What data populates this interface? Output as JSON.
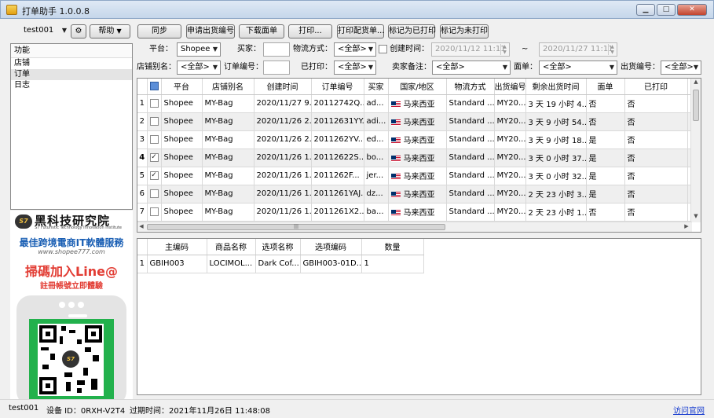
{
  "window": {
    "title": "打单助手 1.0.0.8",
    "icon": "app-icon",
    "min": "▁",
    "max": "□",
    "close": "✕"
  },
  "toolbar": {
    "account": "test001",
    "settings_icon": "gear-icon",
    "help": "帮助",
    "sync": "同步",
    "apply_tracking": "申请出货编号",
    "download_waybill": "下载面单",
    "print": "打印...",
    "print_picklist": "打印配货单...",
    "mark_printed": "标记为已打印",
    "mark_unprinted": "标记为未打印"
  },
  "filters": {
    "platform_label": "平台：",
    "platform": "Shopee",
    "buyer_label": "买家：",
    "buyer": "",
    "logistics_label": "物流方式：",
    "logistics": "<全部>",
    "created_label": "创建时间：",
    "created_checked": false,
    "date_from": "2020/11/12 11:11",
    "date_sep": "~",
    "date_to": "2020/11/27 11:11",
    "store_label": "店铺别名：",
    "store": "<全部>",
    "order_label": "订单编号：",
    "order": "",
    "printed_label": "已打印：",
    "printed": "<全部>",
    "seller_note_label": "卖家备注：",
    "seller_note": "<全部>",
    "waybill_label": "面单：",
    "waybill": "<全部>",
    "shipno_label": "出货编号：",
    "shipno": "<全部>"
  },
  "sidebar": {
    "header": "功能",
    "items": [
      {
        "label": "店铺",
        "selected": false
      },
      {
        "label": "订单",
        "selected": true
      },
      {
        "label": "日志",
        "selected": false
      }
    ]
  },
  "promo": {
    "logo": "S7",
    "brand": "黑科技研究院",
    "brand_sub": "S7 Futuristic Technology Innovation Institute",
    "slogan": "最佳跨境電商IT軟體服務",
    "url": "www.shopee777.com",
    "scan": "掃碼加入Line@",
    "scan_sub": "註冊帳號立即體驗"
  },
  "orders": {
    "columns": [
      "",
      "平台",
      "店铺别名",
      "创建时间",
      "订单编号",
      "买家",
      "国家/地区",
      "物流方式",
      "出货编号",
      "剩余出货时间",
      "面单",
      "已打印",
      ""
    ],
    "rows": [
      {
        "n": "1",
        "checked": false,
        "platform": "Shopee",
        "store": "MY-Bag",
        "created": "2020/11/27 9...",
        "order": "20112742Q...",
        "buyer": "ad...",
        "country": "马来西亚",
        "logistics": "Standard ...",
        "shipno": "MY20...",
        "remain": "3 天 19 小时 4...",
        "waybill": "否",
        "printed": "否",
        "extra": "",
        "current": false
      },
      {
        "n": "2",
        "checked": false,
        "platform": "Shopee",
        "store": "MY-Bag",
        "created": "2020/11/26 2...",
        "order": "20112631YY...",
        "buyer": "adi...",
        "country": "马来西亚",
        "logistics": "Standard ...",
        "shipno": "MY20...",
        "remain": "3 天 9 小时 54...",
        "waybill": "否",
        "printed": "否",
        "extra": "",
        "current": false
      },
      {
        "n": "3",
        "checked": false,
        "platform": "Shopee",
        "store": "MY-Bag",
        "created": "2020/11/26 2...",
        "order": "2011262YV...",
        "buyer": "ed...",
        "country": "马来西亚",
        "logistics": "Standard ...",
        "shipno": "MY20...",
        "remain": "3 天 9 小时 18...",
        "waybill": "是",
        "printed": "否",
        "extra": "",
        "current": false
      },
      {
        "n": "4",
        "checked": true,
        "platform": "Shopee",
        "store": "MY-Bag",
        "created": "2020/11/26 1...",
        "order": "20112622S...",
        "buyer": "bo...",
        "country": "马来西亚",
        "logistics": "Standard ...",
        "shipno": "MY20...",
        "remain": "3 天 0 小时 37...",
        "waybill": "是",
        "printed": "否",
        "extra": "",
        "current": true
      },
      {
        "n": "5",
        "checked": true,
        "platform": "Shopee",
        "store": "MY-Bag",
        "created": "2020/11/26 1...",
        "order": "2011262F...",
        "buyer": "jer...",
        "country": "马来西亚",
        "logistics": "Standard ...",
        "shipno": "MY20...",
        "remain": "3 天 0 小时 32...",
        "waybill": "是",
        "printed": "否",
        "extra": "",
        "current": false
      },
      {
        "n": "6",
        "checked": false,
        "platform": "Shopee",
        "store": "MY-Bag",
        "created": "2020/11/26 1...",
        "order": "2011261YAJ...",
        "buyer": "dz...",
        "country": "马来西亚",
        "logistics": "Standard ...",
        "shipno": "MY20...",
        "remain": "2 天 23 小时 3...",
        "waybill": "是",
        "printed": "否",
        "extra": "",
        "current": false
      },
      {
        "n": "7",
        "checked": false,
        "platform": "Shopee",
        "store": "MY-Bag",
        "created": "2020/11/26 1...",
        "order": "2011261X2...",
        "buyer": "ba...",
        "country": "马来西亚",
        "logistics": "Standard ...",
        "shipno": "MY20...",
        "remain": "2 天 23 小时 1...",
        "waybill": "否",
        "printed": "否",
        "extra": "",
        "current": false
      }
    ]
  },
  "items": {
    "columns": [
      "",
      "主编码",
      "商品名称",
      "选项名称",
      "选项编码",
      "数量"
    ],
    "rows": [
      {
        "n": "1",
        "sku": "GBIH003",
        "name": "LOCIMOL...",
        "option": "Dark Cof...",
        "option_code": "GBIH003-01D...",
        "qty": "1"
      }
    ]
  },
  "status": {
    "account": "test001",
    "device": "设备 ID：0RXH-V2T4",
    "expiry": "过期时间：2021年11月26日 11:48:08",
    "site_link": "访问官网"
  }
}
